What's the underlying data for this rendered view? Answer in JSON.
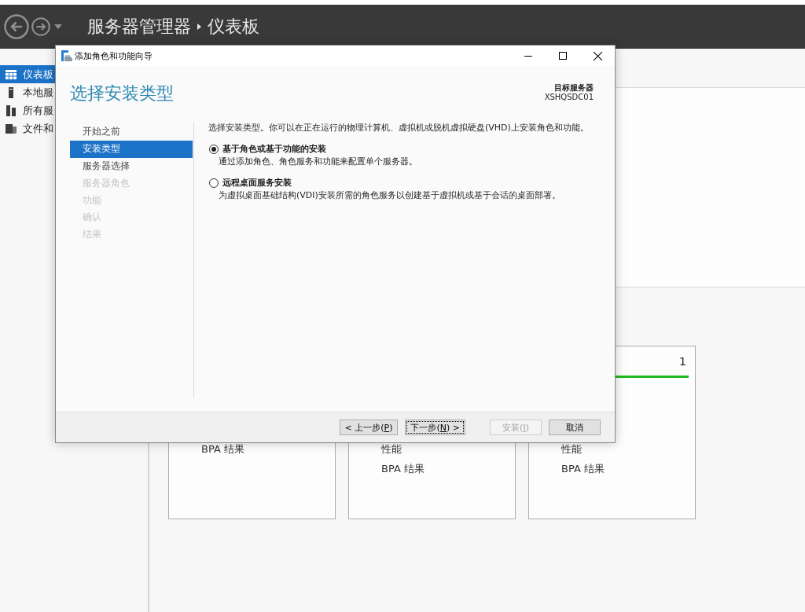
{
  "app": {
    "title": "服务器管理器",
    "page": "仪表板"
  },
  "sidebar": {
    "items": [
      {
        "label": "仪表板",
        "selected": true
      },
      {
        "label": "本地服",
        "selected": false
      },
      {
        "label": "所有服",
        "selected": false
      },
      {
        "label": "文件和",
        "selected": false
      }
    ]
  },
  "tiles": [
    {
      "items": [
        "BPA 结果"
      ]
    },
    {
      "items": [
        "性能",
        "BPA 结果"
      ]
    },
    {
      "count": "1",
      "color": "#1fbb1f",
      "items": [
        "性能",
        "BPA 结果"
      ]
    }
  ],
  "dialog": {
    "title": "添加角色和功能向导",
    "heading": "选择安装类型",
    "target_label": "目标服务器",
    "target_server": "XSHQSDC01",
    "steps": [
      {
        "label": "开始之前",
        "selected": false,
        "disabled": false
      },
      {
        "label": "安装类型",
        "selected": true,
        "disabled": false
      },
      {
        "label": "服务器选择",
        "selected": false,
        "disabled": false
      },
      {
        "label": "服务器角色",
        "selected": false,
        "disabled": true
      },
      {
        "label": "功能",
        "selected": false,
        "disabled": true
      },
      {
        "label": "确认",
        "selected": false,
        "disabled": true
      },
      {
        "label": "结果",
        "selected": false,
        "disabled": true
      }
    ],
    "intro": "选择安装类型。你可以在正在运行的物理计算机、虚拟机或脱机虚拟硬盘(VHD)上安装角色和功能。",
    "options": [
      {
        "label": "基于角色或基于功能的安装",
        "description": "通过添加角色、角色服务和功能来配置单个服务器。",
        "selected": true
      },
      {
        "label": "远程桌面服务安装",
        "description": "为虚拟桌面基础结构(VDI)安装所需的角色服务以创建基于虚拟机或基于会话的桌面部署。",
        "selected": false
      }
    ],
    "buttons": [
      {
        "text_before": "< 上一步(",
        "access_key": "P",
        "text_after": ")",
        "disabled": false,
        "focused": false
      },
      {
        "text_before": "下一步(",
        "access_key": "N",
        "text_after": ") >",
        "disabled": false,
        "focused": true
      },
      {
        "text_before": "安装(",
        "access_key": "I",
        "text_after": ")",
        "disabled": true,
        "focused": false
      },
      {
        "text_before": "取消",
        "disabled": false,
        "focused": false
      }
    ]
  }
}
